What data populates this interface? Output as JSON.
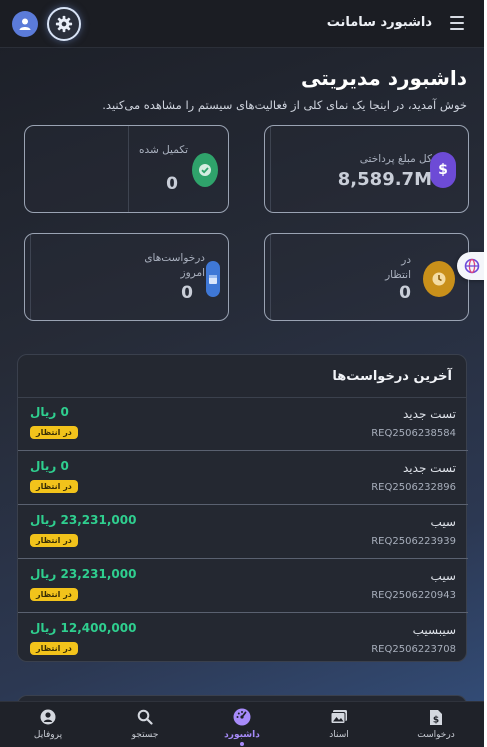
{
  "header": {
    "title": "داشبورد سامانت",
    "avatar_icon": "user-icon",
    "settings_icon": "gear-icon",
    "menu_icon": "hamburger-icon"
  },
  "page": {
    "title": "داشبورد مدیریتی",
    "subtitle": "خوش آمدید، در اینجا یک نمای کلی از فعالیت‌های سیستم را مشاهده می‌کنید."
  },
  "stats": [
    {
      "label": "کل مبلغ پرداختی",
      "value": "8,589.7M",
      "icon": "dollar-icon",
      "color": "#6d4bd6"
    },
    {
      "label": "تکمیل شده",
      "value": "0",
      "icon": "check-circle-icon",
      "color": "#2fa36b"
    },
    {
      "label": "در انتظار",
      "value": "0",
      "icon": "clock-icon",
      "color": "#c9901a"
    },
    {
      "label": "درخواست‌های امروز",
      "value": "0",
      "icon": "calendar-icon",
      "color": "#3f78d6"
    }
  ],
  "lang_icon": "language-icon",
  "requests": {
    "title": "آخرین درخواست‌ها",
    "items": [
      {
        "name": "تست جدید",
        "code": "REQ2506238584",
        "amount": "0 ریال",
        "status": "در انتظار"
      },
      {
        "name": "تست جدید",
        "code": "REQ2506232896",
        "amount": "0 ریال",
        "status": "در انتظار"
      },
      {
        "name": "سیب",
        "code": "REQ2506223939",
        "amount": "23,231,000 ریال",
        "status": "در انتظار"
      },
      {
        "name": "سیب",
        "code": "REQ2506220943",
        "amount": "23,231,000 ریال",
        "status": "در انتظار"
      },
      {
        "name": "سیبسیب",
        "code": "REQ2506223708",
        "amount": "12,400,000 ریال",
        "status": "در انتظار"
      }
    ]
  },
  "nav": [
    {
      "label": "پروفایل",
      "icon": "profile-icon"
    },
    {
      "label": "جستجو",
      "icon": "search-icon"
    },
    {
      "label": "داشبورد",
      "icon": "dashboard-icon",
      "active": true
    },
    {
      "label": "اسناد",
      "icon": "documents-icon"
    },
    {
      "label": "درخواست",
      "icon": "request-icon"
    }
  ]
}
